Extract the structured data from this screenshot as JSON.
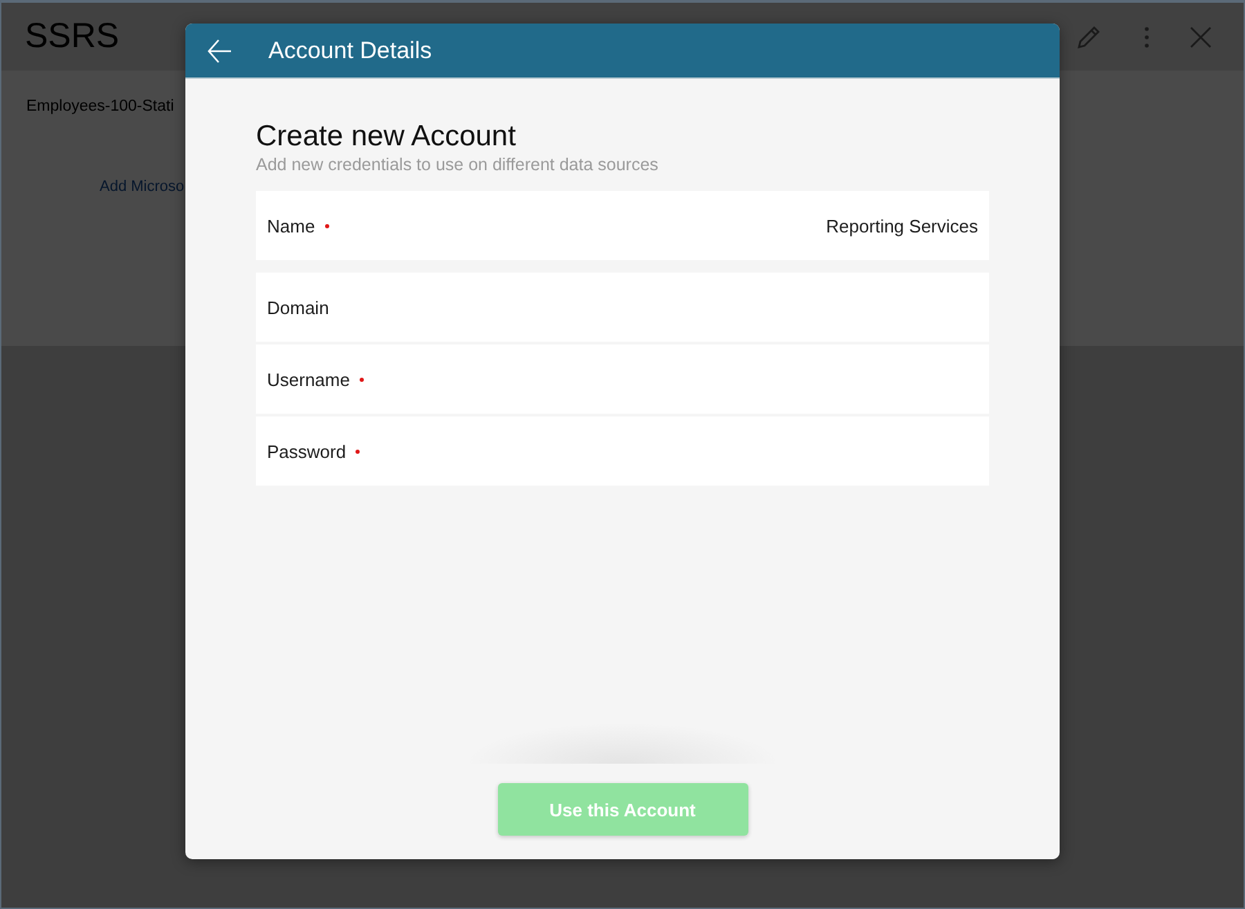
{
  "app": {
    "title": "SSRS",
    "item": "Employees-100-Stati",
    "link": "Add Microso"
  },
  "dialog": {
    "title": "Account Details",
    "heading": "Create new Account",
    "subtitle": "Add new credentials to use on different data sources",
    "sections": [
      {
        "fields": [
          {
            "label": "Name",
            "required": true,
            "value": "Reporting Services"
          }
        ]
      },
      {
        "fields": [
          {
            "label": "Domain",
            "required": false
          },
          {
            "label": "Username",
            "required": true
          },
          {
            "label": "Password",
            "required": true
          }
        ]
      }
    ],
    "button": {
      "label": "Use this Account",
      "disabled": true
    }
  }
}
